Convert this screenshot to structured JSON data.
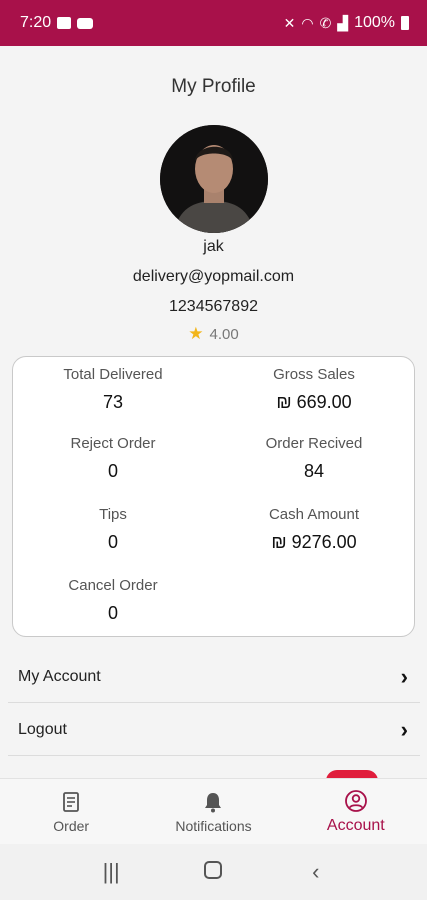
{
  "status_bar": {
    "time": "7:20",
    "battery": "100%"
  },
  "page_title": "My Profile",
  "profile": {
    "name": "jak",
    "email": "delivery@yopmail.com",
    "phone": "1234567892",
    "rating": "4.00"
  },
  "stats": [
    {
      "label": "Total Delivered",
      "value": "73"
    },
    {
      "label": "Gross Sales",
      "value": "₪ 669.00"
    },
    {
      "label": "Reject Order",
      "value": "0"
    },
    {
      "label": "Order Recived",
      "value": "84"
    },
    {
      "label": "Tips",
      "value": "0"
    },
    {
      "label": "Cash Amount",
      "value": "₪ 9276.00"
    },
    {
      "label": "Cancel Order",
      "value": "0"
    }
  ],
  "menu": [
    {
      "label": "My Account",
      "icon": "chevron-right-icon"
    },
    {
      "label": "Logout",
      "icon": "chevron-right-icon"
    }
  ],
  "bottom_nav": [
    {
      "label": "Order",
      "icon": "receipt-icon",
      "active": false
    },
    {
      "label": "Notifications",
      "icon": "bell-icon",
      "active": false
    },
    {
      "label": "Account",
      "icon": "account-icon",
      "active": true
    }
  ],
  "colors": {
    "brand": "#a8114a",
    "star": "#f2b51a",
    "badge": "#e01e3c"
  }
}
